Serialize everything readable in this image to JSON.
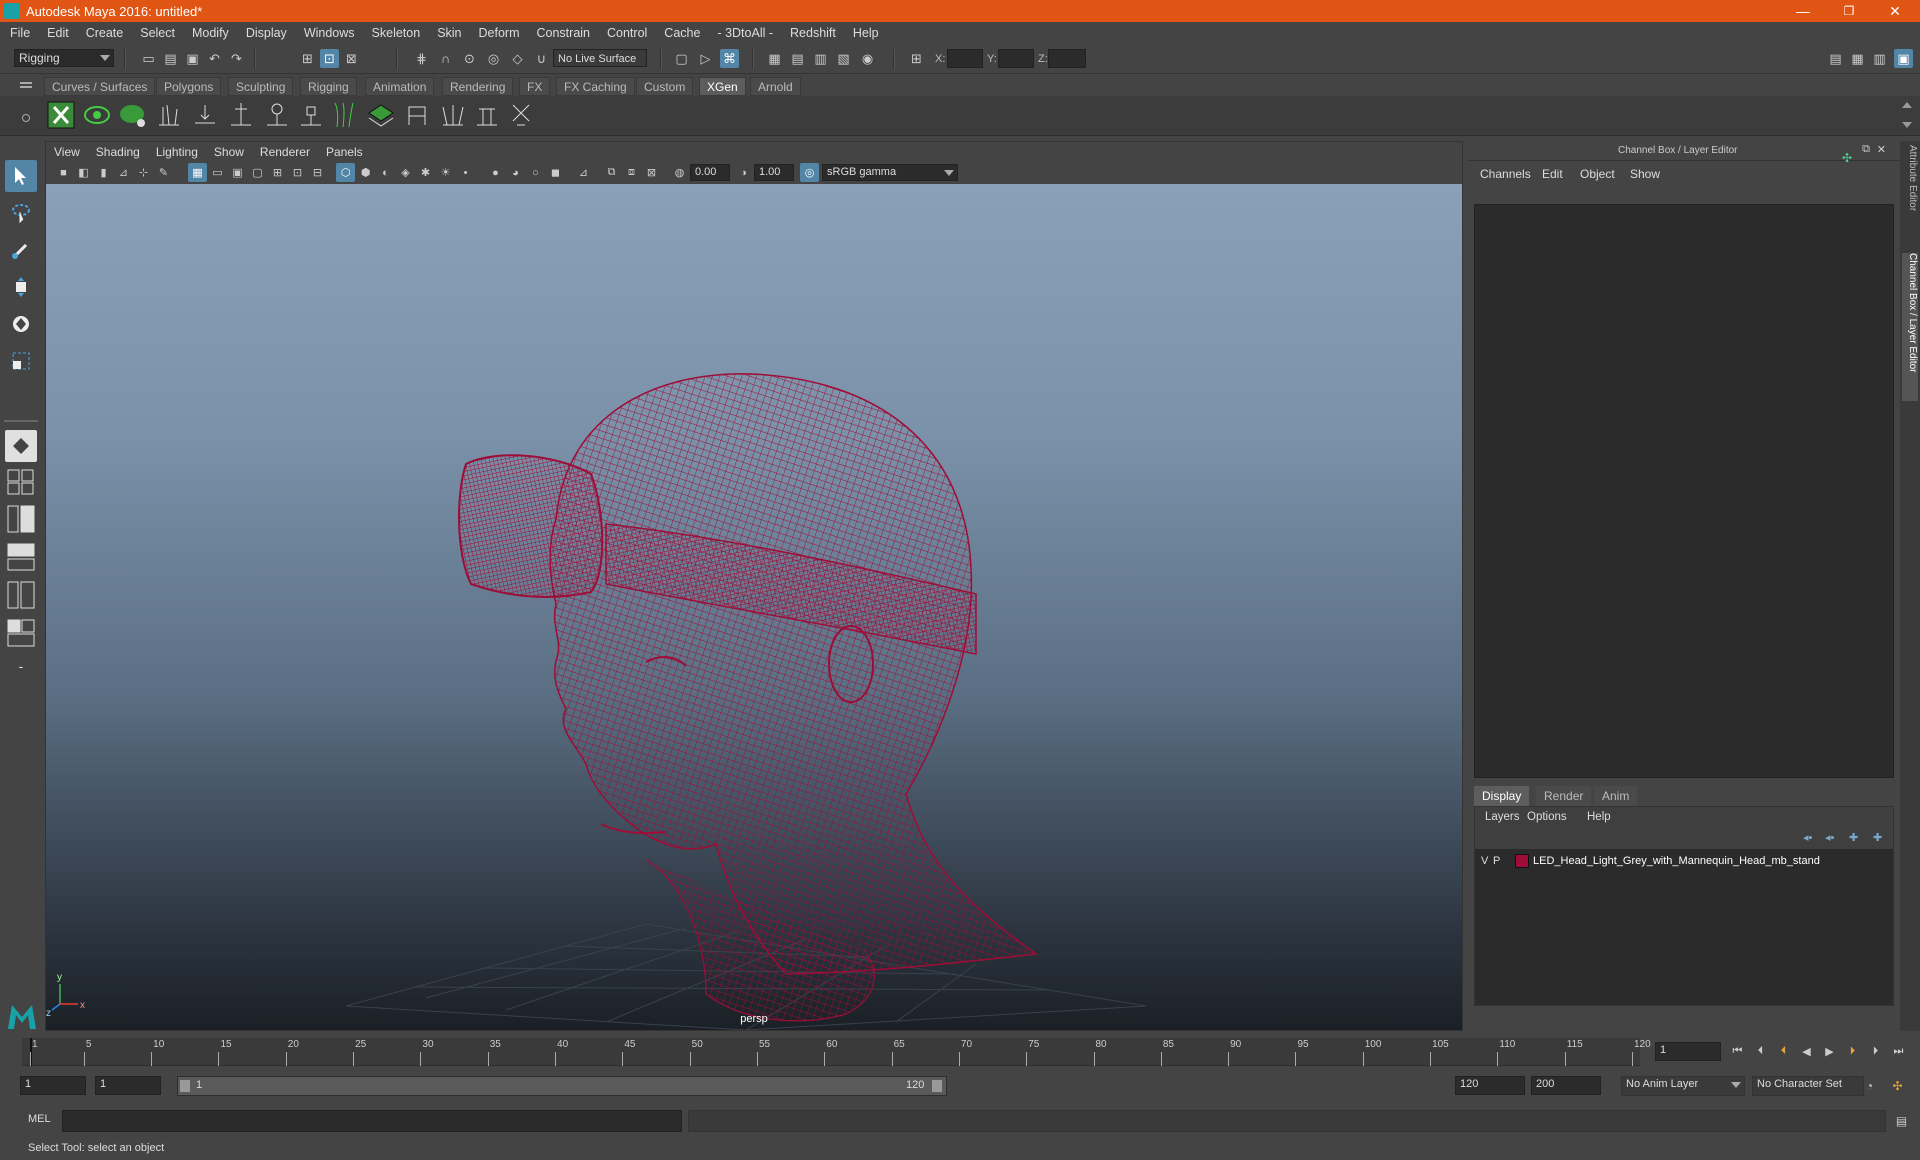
{
  "window": {
    "title": "Autodesk Maya 2016: untitled*",
    "minimize": "—",
    "restore": "❐",
    "close": "✕"
  },
  "menubar": [
    "File",
    "Edit",
    "Create",
    "Select",
    "Modify",
    "Display",
    "Windows",
    "Skeleton",
    "Skin",
    "Deform",
    "Constrain",
    "Control",
    "Cache",
    "- 3DtoAll -",
    "Redshift",
    "Help"
  ],
  "statusline": {
    "menuset": "Rigging",
    "live_surface": "No Live Surface",
    "x_label": "X:",
    "y_label": "Y:",
    "z_label": "Z:"
  },
  "shelf_tabs": [
    "Curves / Surfaces",
    "Polygons",
    "Sculpting",
    "Rigging",
    "Animation",
    "Rendering",
    "FX",
    "FX Caching",
    "Custom",
    "XGen",
    "Arnold"
  ],
  "shelf_active": "XGen",
  "viewport": {
    "menus": [
      "View",
      "Shading",
      "Lighting",
      "Show",
      "Renderer",
      "Panels"
    ],
    "exposure": "0.00",
    "gamma": "1.00",
    "color_space": "sRGB gamma",
    "camera_label": "persp",
    "axis_y": "y",
    "axis_x": "x",
    "axis_z": "z",
    "wire_color": "#9e0d37"
  },
  "channel_box": {
    "title": "Channel Box / Layer Editor",
    "menus": [
      "Channels",
      "Edit",
      "Object",
      "Show"
    ],
    "side_tabs": [
      "Attribute Editor",
      "Channel Box / Layer Editor"
    ]
  },
  "layer_editor": {
    "tabs": [
      "Display",
      "Render",
      "Anim"
    ],
    "active_tab": "Display",
    "menus": [
      "Layers",
      "Options",
      "Help"
    ],
    "layers": [
      {
        "v": "V",
        "p": "P",
        "color": "#9e0d37",
        "name": "LED_Head_Light_Grey_with_Mannequin_Head_mb_stand"
      }
    ]
  },
  "timeline": {
    "ticks": [
      "1",
      "5",
      "10",
      "15",
      "20",
      "25",
      "30",
      "35",
      "40",
      "45",
      "50",
      "55",
      "60",
      "65",
      "70",
      "75",
      "80",
      "85",
      "90",
      "95",
      "100",
      "105",
      "110",
      "115",
      "120"
    ],
    "current_frame": "1"
  },
  "range": {
    "start": "1",
    "anim_start": "1",
    "slider_start": "1",
    "slider_end": "120",
    "end": "120",
    "anim_end": "200",
    "anim_layer": "No Anim Layer",
    "char_set": "No Character Set"
  },
  "cmdline": {
    "label": "MEL"
  },
  "help_line": "Select Tool: select an object"
}
